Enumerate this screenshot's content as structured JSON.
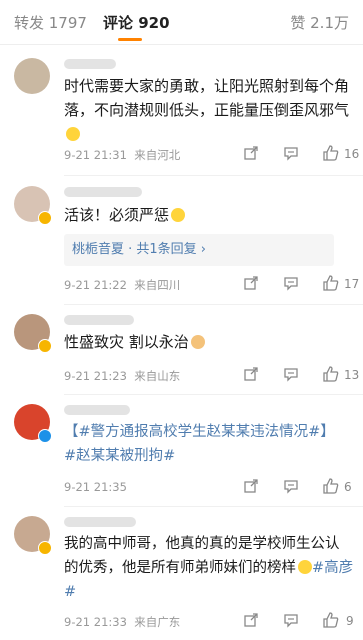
{
  "tabs": {
    "repost": "转发 1797",
    "comments": "评论 920",
    "likes": "赞 2.1万"
  },
  "comments": [
    {
      "text": "时代需要大家的勇敢，让阳光照射到每个角落，不向潜规则低头，正能量压倒歪风邪气",
      "time": "9-21 21:31",
      "location": "来自河北",
      "likes": "16"
    },
    {
      "text": "活该！必须严惩",
      "reply": "桃栀音夏 · 共1条回复 ›",
      "time": "9-21 21:22",
      "location": "来自四川",
      "likes": "17"
    },
    {
      "text": "性盛致灾 割以永治",
      "time": "9-21 21:23",
      "location": "来自山东",
      "likes": "13"
    },
    {
      "text_line1": "【#警方通报高校学生赵某某违法情况#】",
      "text_line2": "#赵某某被刑拘#",
      "time": "9-21 21:35",
      "location": "",
      "likes": "6"
    },
    {
      "text_line1": "我的高中师哥，他真的真的是学校师生公认",
      "text_line2": "的优秀，他是所有师弟师妹们的榜样",
      "text_line3": "#高彦#",
      "time": "9-21 21:33",
      "location": "来自广东",
      "likes": "9"
    }
  ],
  "icons": {
    "share": "share-icon",
    "comment": "comment-icon",
    "like": "thumbs-up-icon"
  },
  "colors": {
    "accent": "#ff8200",
    "link": "#507daf",
    "gold_badge": "#f7b500",
    "blue_badge": "#1d91e8"
  }
}
